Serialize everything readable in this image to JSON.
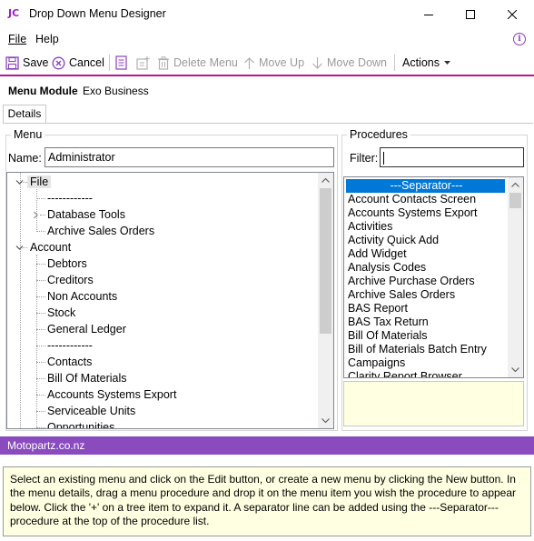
{
  "window": {
    "logo": "JC",
    "title": "Drop Down Menu Designer",
    "minimize_icon": "minimize-icon",
    "maximize_icon": "maximize-icon",
    "close_icon": "close-icon"
  },
  "menubar": {
    "items": [
      {
        "label": "File"
      },
      {
        "label": "Help"
      }
    ],
    "info_icon": "info-icon"
  },
  "toolbar": {
    "save": "Save",
    "cancel": "Cancel",
    "delete_menu": "Delete Menu",
    "move_up": "Move Up",
    "move_down": "Move Down",
    "actions": "Actions"
  },
  "module": {
    "label": "Menu Module",
    "value": "Exo Business"
  },
  "tabs": [
    {
      "label": "Details"
    }
  ],
  "menu_group": {
    "title": "Menu",
    "name_label": "Name:",
    "name_value": "Administrator",
    "tree": [
      {
        "label": "File"
      },
      {
        "label": "------------"
      },
      {
        "label": "Database Tools"
      },
      {
        "label": "Archive Sales Orders"
      },
      {
        "label": "Account"
      },
      {
        "label": "Debtors"
      },
      {
        "label": "Creditors"
      },
      {
        "label": "Non Accounts"
      },
      {
        "label": "Stock"
      },
      {
        "label": "General Ledger"
      },
      {
        "label": "------------"
      },
      {
        "label": "Contacts"
      },
      {
        "label": "Bill Of Materials"
      },
      {
        "label": "Accounts Systems Export"
      },
      {
        "label": "Serviceable Units"
      },
      {
        "label": "Opportunities"
      }
    ]
  },
  "procedures_group": {
    "title": "Procedures",
    "filter_label": "Filter:",
    "filter_value": "",
    "items": [
      "---Separator---",
      "Account Contacts Screen",
      "Accounts Systems Export",
      "Activities",
      "Activity Quick Add",
      "Add Widget",
      "Analysis Codes",
      "Archive Purchase Orders",
      "Archive Sales Orders",
      "BAS Report",
      "BAS Tax Return",
      "Bill Of Materials",
      "Bill of Materials Batch Entry",
      "Campaigns",
      "Clarity Report Browser"
    ],
    "selected_index": 0
  },
  "status": {
    "text": "Motopartz.co.nz"
  },
  "help": {
    "text": "Select an existing menu and click on the Edit button, or create a new menu by clicking the New button. In the menu details, drag a menu procedure and drop it on the menu item you wish the procedure to appear below. Click the '+' on a tree item to expand it. A separator line can be added using the ---Separator--- procedure at the top of the procedure list."
  },
  "colors": {
    "accent": "#b3179a",
    "status_bar": "#8a4bbf",
    "selection": "#0078d7",
    "info_background": "#ffffe1"
  }
}
